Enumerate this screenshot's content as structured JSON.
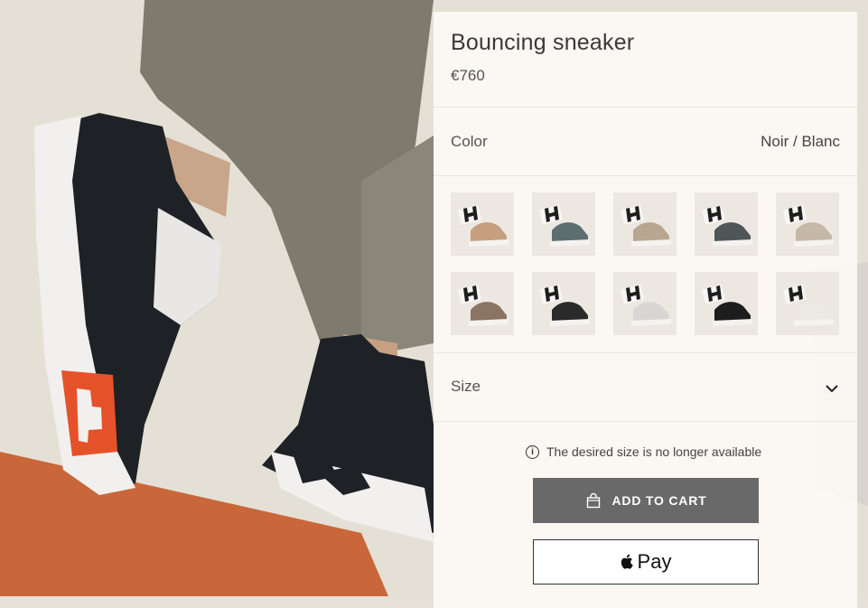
{
  "product": {
    "title": "Bouncing sneaker",
    "price": "€760"
  },
  "color": {
    "label": "Color",
    "selected": "Noir / Blanc",
    "swatches": [
      {
        "name": "camel",
        "color": "#c59f7f"
      },
      {
        "name": "steel-blue",
        "color": "#5d6e70"
      },
      {
        "name": "taupe",
        "color": "#b9a690"
      },
      {
        "name": "slate",
        "color": "#4f5658"
      },
      {
        "name": "sand",
        "color": "#c6b8a6"
      },
      {
        "name": "brown",
        "color": "#8c7462"
      },
      {
        "name": "black",
        "color": "#2a2a2a"
      },
      {
        "name": "white-grey",
        "color": "#d7d6d2"
      },
      {
        "name": "all-black",
        "color": "#1d1d1d"
      },
      {
        "name": "off-white",
        "color": "#ece9e3"
      }
    ]
  },
  "size": {
    "label": "Size",
    "icon": "chevron-down-icon"
  },
  "notice": {
    "text": "The desired size is no longer available",
    "icon": "info-icon"
  },
  "actions": {
    "add_to_cart": "ADD TO CART",
    "add_to_cart_icon": "shopping-bag-icon",
    "apple_pay": "Pay",
    "apple_pay_icon": "apple-icon"
  },
  "theme": {
    "button_bg": "#696969",
    "panel_bg": "#fdfaf5",
    "accent_orange": "#e5522a"
  }
}
